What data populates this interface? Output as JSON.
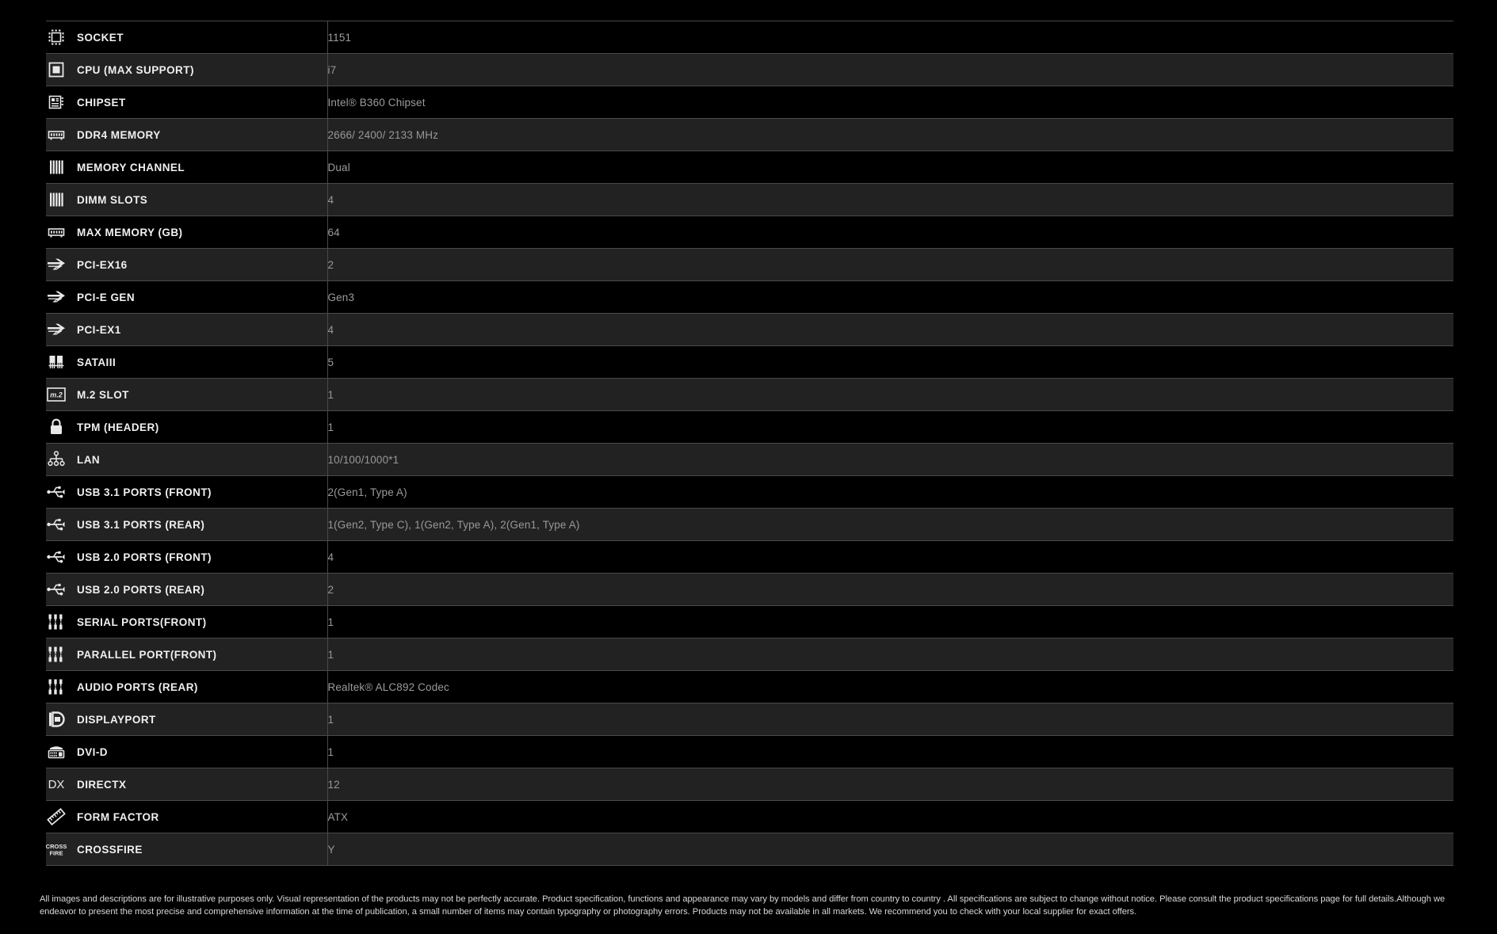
{
  "table": {
    "rows": [
      {
        "icon": "socket-icon",
        "label": "SOCKET",
        "value": "1151"
      },
      {
        "icon": "cpu-icon",
        "label": "CPU (MAX SUPPORT)",
        "value": "i7"
      },
      {
        "icon": "chipset-icon",
        "label": "CHIPSET",
        "value": "Intel® B360 Chipset"
      },
      {
        "icon": "memory-module-icon",
        "label": "DDR4 MEMORY",
        "value": "2666/ 2400/ 2133 MHz"
      },
      {
        "icon": "memory-channel-icon",
        "label": "MEMORY CHANNEL",
        "value": "Dual"
      },
      {
        "icon": "dimm-slots-icon",
        "label": "DIMM SLOTS",
        "value": "4"
      },
      {
        "icon": "memory-module-icon",
        "label": "MAX MEMORY (GB)",
        "value": "64"
      },
      {
        "icon": "pcie-arrow-icon",
        "label": "PCI-EX16",
        "value": "2"
      },
      {
        "icon": "pcie-arrow-icon",
        "label": "PCI-E GEN",
        "value": "Gen3"
      },
      {
        "icon": "pcie-arrow-icon",
        "label": "PCI-EX1",
        "value": "4"
      },
      {
        "icon": "sata-icon",
        "label": "SATAIII",
        "value": "5"
      },
      {
        "icon": "m2-slot-icon",
        "label": "M.2 SLOT",
        "value": "1"
      },
      {
        "icon": "lock-icon",
        "label": "TPM (HEADER)",
        "value": "1"
      },
      {
        "icon": "lan-network-icon",
        "label": "LAN",
        "value": "10/100/1000*1"
      },
      {
        "icon": "usb-icon",
        "label": "USB 3.1 PORTS (FRONT)",
        "value": "2(Gen1, Type A)"
      },
      {
        "icon": "usb-icon",
        "label": "USB 3.1 PORTS (REAR)",
        "value": "1(Gen2, Type C), 1(Gen2, Type A), 2(Gen1, Type A)"
      },
      {
        "icon": "usb-icon",
        "label": "USB 2.0 PORTS (FRONT)",
        "value": "4"
      },
      {
        "icon": "usb-icon",
        "label": "USB 2.0 PORTS (REAR)",
        "value": "2"
      },
      {
        "icon": "audio-jack-icon",
        "label": "SERIAL PORTS(FRONT)",
        "value": "1"
      },
      {
        "icon": "audio-jack-icon",
        "label": "PARALLEL PORT(FRONT)",
        "value": "1"
      },
      {
        "icon": "audio-jack-icon",
        "label": "AUDIO PORTS (REAR)",
        "value": "Realtek® ALC892 Codec"
      },
      {
        "icon": "displayport-icon",
        "label": "DISPLAYPORT",
        "value": "1"
      },
      {
        "icon": "dvi-icon",
        "label": "DVI-D",
        "value": "1"
      },
      {
        "icon": "directx-icon",
        "label": "DIRECTX",
        "value": "12"
      },
      {
        "icon": "ruler-icon",
        "label": "FORM FACTOR",
        "value": "ATX"
      },
      {
        "icon": "crossfire-icon",
        "label": "CROSSFIRE",
        "value": "Y"
      }
    ]
  },
  "footer": {
    "disclaimer": "All images and descriptions are for illustrative purposes only. Visual representation of the products may not be perfectly accurate. Product specification, functions and appearance may vary by models and differ from country to country . All specifications are subject to change without notice. Please consult the product specifications page for full details.Although we endeavor to present the most precise and comprehensive information at the time of publication, a small number of items may contain typography or photography errors. Products may not be available in all markets. We recommend you to check with your local supplier for exact offers."
  },
  "colors": {
    "background": "#000000",
    "row_alt": "#222222",
    "border": "#4a4a4a",
    "label_text": "#f0f0f0",
    "value_text": "#9b9b9b",
    "disclaimer_text": "#d8d8d8"
  }
}
